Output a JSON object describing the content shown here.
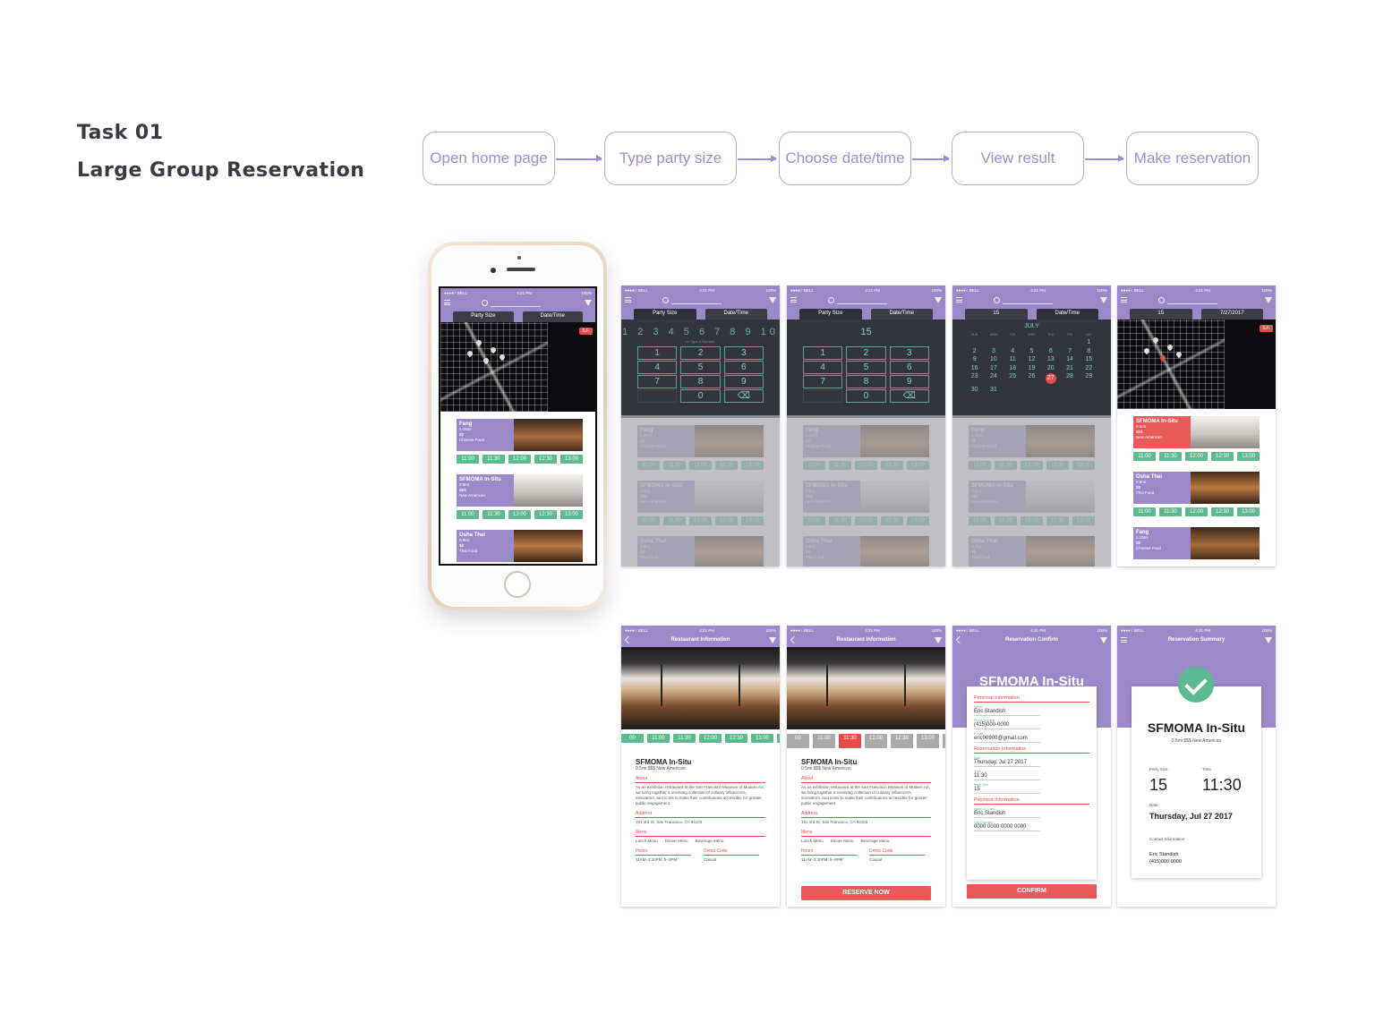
{
  "task": {
    "number": "Task 01",
    "name": "Large Group Reservation"
  },
  "flow": [
    "Open home page",
    "Type party size",
    "Choose date/time",
    "View result",
    "Make reservation"
  ],
  "status_bar": {
    "carrier": "●●●●○ BELL",
    "time": "4:21 PM",
    "battery": "100%"
  },
  "tabs": {
    "party_size": "Party Size",
    "date_time": "Date/Time"
  },
  "selected": {
    "party": "15",
    "date": "7/27/2017"
  },
  "map": {
    "badge": "S.F."
  },
  "restaurants": [
    {
      "name": "Fang",
      "distance": "1.15mi",
      "price": "$$",
      "cuisine": "Chinese Food"
    },
    {
      "name": "SFMOMA In-Situ",
      "distance": "0.5mi",
      "price": "$$$",
      "cuisine": "New American"
    },
    {
      "name": "Osha Thai",
      "distance": "0.9mi",
      "price": "$$",
      "cuisine": "Thai Food"
    }
  ],
  "time_slots": [
    "11:00",
    "11:30",
    "12:00",
    "12:30",
    "13:00"
  ],
  "keypad": {
    "number_row": "1 2 3 4 5 6 7 8 9 10",
    "hint": "or Type A Number",
    "keys": [
      "1",
      "2",
      "3",
      "4",
      "5",
      "6",
      "7",
      "8",
      "9",
      "",
      "0",
      "⌫"
    ]
  },
  "calendar": {
    "month": "JULY",
    "days_of_week": [
      "SUN",
      "MON",
      "TUE",
      "WED",
      "THU",
      "FRI",
      "SAT"
    ],
    "days": [
      "",
      "",
      "",
      "",
      "",
      "",
      "1",
      "2",
      "3",
      "4",
      "5",
      "6",
      "7",
      "8",
      "9",
      "10",
      "11",
      "12",
      "13",
      "14",
      "15",
      "16",
      "17",
      "18",
      "19",
      "20",
      "21",
      "22",
      "23",
      "24",
      "25",
      "26",
      "27",
      "28",
      "29",
      "30",
      "31"
    ],
    "selected_day": "27"
  },
  "detail": {
    "screen_title": "Restaurant Information",
    "name": "SFMOMA In-Situ",
    "distance": "0.5mi",
    "price": "$$$",
    "cuisine": "New American",
    "about_label": "About",
    "about_text": "As an exhibition restaurant at the San Francisco Museum of Modern Art, we bring together a revolving collection of culinary influencers, innovators, and icons to make their contributions accessible for greater public engagement.",
    "address_label": "Address",
    "address": "151 3rd St, San Francisco, CA 94103",
    "menu_label": "Menu",
    "menus": [
      "Lunch Menu",
      "Dinner Menu",
      "Beverage Menu"
    ],
    "hours_label": "Hours",
    "hours": "11AM–3:30PM, 5–9PM",
    "dress_label": "Dress Code",
    "dress": "Casual",
    "time_slots": [
      "00",
      "11:00",
      "11:30",
      "12:00",
      "12:30",
      "13:00",
      "13"
    ],
    "selected_time": "11:30",
    "reserve_button": "RESERVE NOW"
  },
  "confirm": {
    "screen_title": "Reservation Confirm",
    "personal_label": "Personal Information",
    "name_label": "Name",
    "name": "Eric Standish",
    "phone_label": "Phone Number",
    "phone": "(415)000-0000",
    "email_label": "E-mail",
    "email": "eric00900@gmail.com",
    "reservation_label": "Reservation Information",
    "date_label": "Date",
    "date": "Thursday, Jul 27 2017",
    "time_label": "Time",
    "time": "11:30",
    "party_label": "Party Size",
    "party": "15",
    "payment_label": "Payment Information",
    "card_name_label": "Name on Card",
    "card_name": "Eric Standish",
    "card_number_label": "Card Number",
    "card_number": "0000 0000 0000 0000",
    "confirm_button": "CONFIRM"
  },
  "summary": {
    "screen_title": "Reservation Summary",
    "party_label": "Party Size",
    "party": "15",
    "time_label": "Time",
    "time": "11:30",
    "date_label": "Date",
    "date": "Thursday, Jul 27 2017",
    "contact_label": "Contact Information:",
    "contact_name": "Eric Standish",
    "contact_phone": "(415)000-0000"
  },
  "colors": {
    "purple": "#9b8ac9",
    "green": "#5cba8e",
    "red": "#e84b4b",
    "dark": "#33363f"
  }
}
